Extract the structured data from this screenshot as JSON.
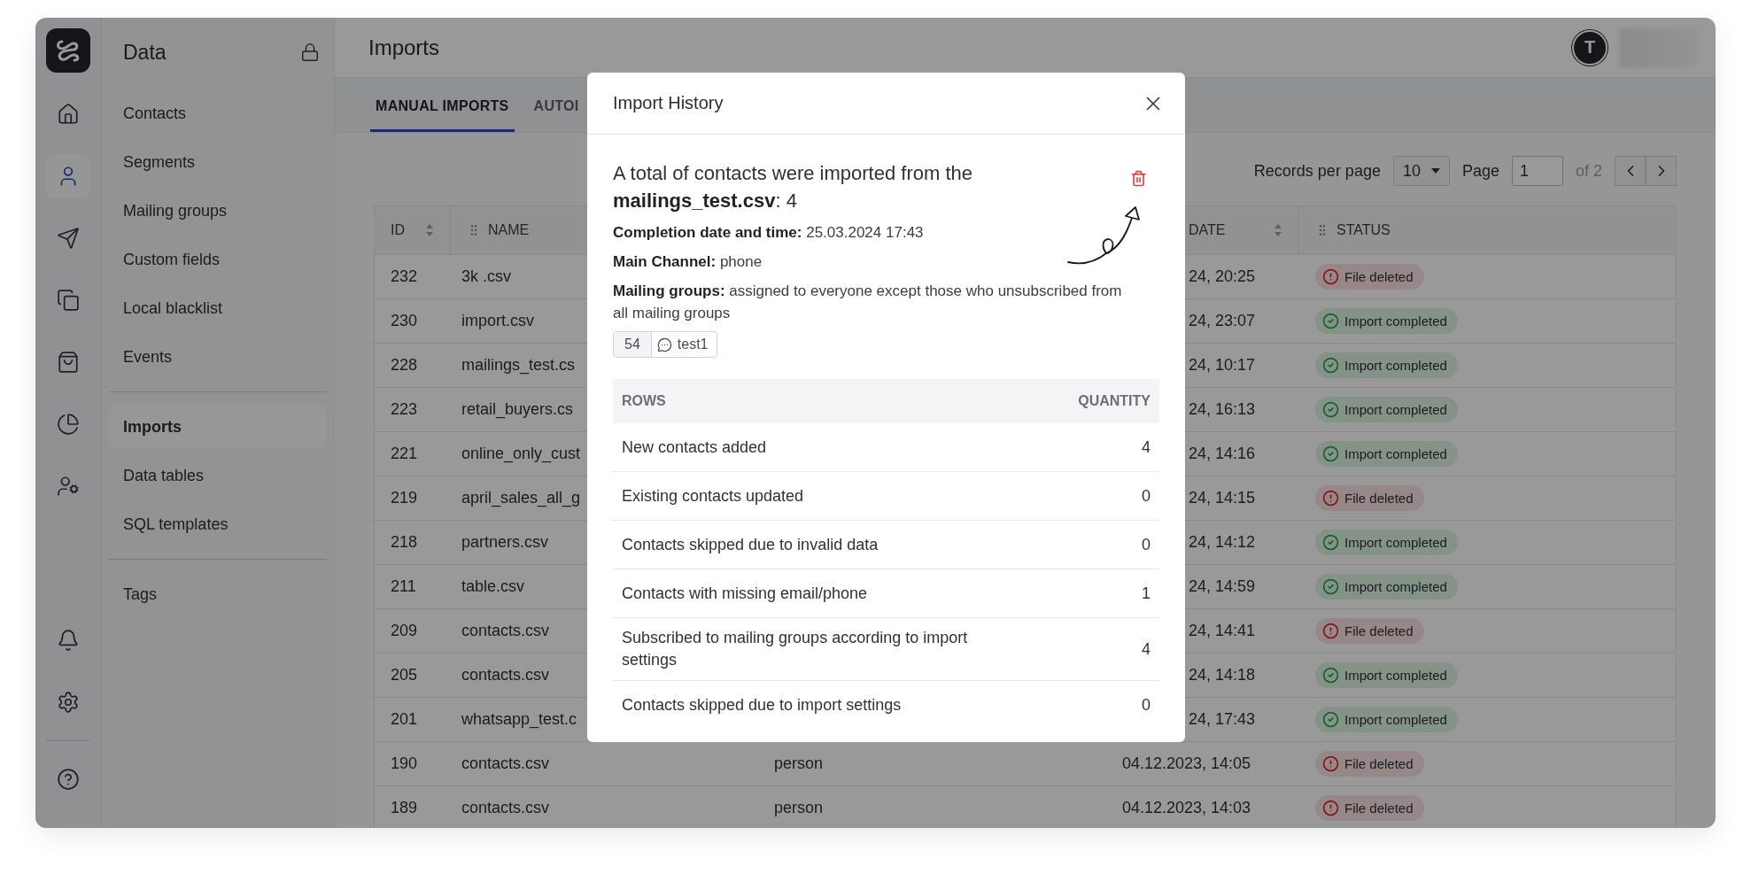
{
  "rail": {
    "top": [
      {
        "selected": false
      },
      {
        "selected": true
      },
      {
        "selected": false
      },
      {
        "selected": false
      },
      {
        "selected": false
      },
      {
        "selected": false
      },
      {
        "selected": false
      }
    ],
    "bottom": [
      {
        "selected": false
      },
      {
        "selected": false
      },
      {
        "selected": false
      }
    ]
  },
  "sidebar": {
    "title": "Data",
    "sections": [
      [
        {
          "label": "Contacts",
          "selected": false
        },
        {
          "label": "Segments",
          "selected": false
        },
        {
          "label": "Mailing groups",
          "selected": false
        },
        {
          "label": "Custom fields",
          "selected": false
        },
        {
          "label": "Local blacklist",
          "selected": false
        },
        {
          "label": "Events",
          "selected": false
        }
      ],
      [
        {
          "label": "Imports",
          "selected": true
        },
        {
          "label": "Data tables",
          "selected": false
        },
        {
          "label": "SQL templates",
          "selected": false
        }
      ],
      [
        {
          "label": "Tags",
          "selected": false
        }
      ]
    ]
  },
  "header": {
    "title": "Imports",
    "avatar": "T"
  },
  "tabs": [
    {
      "label": "MANUAL IMPORTS",
      "selected": true
    },
    {
      "label": "AUTOI",
      "selected": false
    }
  ],
  "pagination": {
    "records_label": "Records per page",
    "per_page": "10",
    "page_label": "Page",
    "page": "1",
    "of": "of 2"
  },
  "table": {
    "columns": [
      {
        "label": "ID",
        "kind": "sort"
      },
      {
        "label": "NAME",
        "kind": "drag"
      },
      {
        "label": "DATE",
        "kind": "sort"
      },
      {
        "label": "STATUS",
        "kind": "drag"
      }
    ],
    "rows": [
      {
        "kind": "covered",
        "id": "232",
        "name": "3k .csv",
        "date": "24, 20:25",
        "status": {
          "kind": "error",
          "label": "File deleted"
        }
      },
      {
        "kind": "covered",
        "id": "230",
        "name": "import.csv",
        "date": "24, 23:07",
        "status": {
          "kind": "success",
          "label": "Import completed"
        }
      },
      {
        "kind": "covered",
        "id": "228",
        "name": "mailings_test.cs",
        "date": "24, 10:17",
        "status": {
          "kind": "success",
          "label": "Import completed"
        }
      },
      {
        "kind": "covered",
        "id": "223",
        "name": "retail_buyers.cs",
        "date": "24, 16:13",
        "status": {
          "kind": "success",
          "label": "Import completed"
        }
      },
      {
        "kind": "covered",
        "id": "221",
        "name": "online_only_cust",
        "date": "24, 14:16",
        "status": {
          "kind": "success",
          "label": "Import completed"
        }
      },
      {
        "kind": "covered",
        "id": "219",
        "name": "april_sales_all_g",
        "date": "24, 14:15",
        "status": {
          "kind": "error",
          "label": "File deleted"
        }
      },
      {
        "kind": "covered",
        "id": "218",
        "name": "partners.csv",
        "date": "24, 14:12",
        "status": {
          "kind": "success",
          "label": "Import completed"
        }
      },
      {
        "kind": "covered",
        "id": "211",
        "name": "table.csv",
        "date": "24, 14:59",
        "status": {
          "kind": "success",
          "label": "Import completed"
        }
      },
      {
        "kind": "covered",
        "id": "209",
        "name": "contacts.csv",
        "date": "24, 14:41",
        "status": {
          "kind": "error",
          "label": "File deleted"
        }
      },
      {
        "kind": "covered",
        "id": "205",
        "name": "contacts.csv",
        "date": "24, 14:18",
        "status": {
          "kind": "success",
          "label": "Import completed"
        }
      },
      {
        "kind": "covered",
        "id": "201",
        "name": "whatsapp_test.c",
        "date": "24, 17:43",
        "status": {
          "kind": "success",
          "label": "Import completed"
        }
      },
      {
        "kind": "full",
        "id": "190",
        "name": "contacts.csv",
        "channel": "person",
        "date": "04.12.2023, 14:05",
        "status": {
          "kind": "error",
          "label": "File deleted"
        }
      },
      {
        "kind": "full",
        "id": "189",
        "name": "contacts.csv",
        "channel": "person",
        "date": "04.12.2023, 14:03",
        "status": {
          "kind": "error",
          "label": "File deleted"
        }
      }
    ]
  },
  "modal": {
    "title": "Import History",
    "summary": "A total of contacts were imported from the **mailings_test.csv**: 4",
    "details": [
      "**Completion date and time:** 25.03.2024 17:43",
      "**Main Channel:** phone",
      "**Mailing groups:** assigned to everyone except those who unsubscribed from all mailing groups"
    ],
    "tag": {
      "count": "54",
      "name": "test1"
    },
    "columns": [
      "ROWS",
      "QUANTITY"
    ],
    "rows": [
      {
        "label": "New contacts added",
        "value": "4"
      },
      {
        "label": "Existing contacts updated",
        "value": "0"
      },
      {
        "label": "Contacts skipped due to invalid data",
        "value": "0"
      },
      {
        "label": "Contacts with missing email/phone",
        "value": "1"
      },
      {
        "label": "Subscribed to mailing groups according to import settings",
        "value": "4"
      },
      {
        "label": "Contacts skipped due to import settings",
        "value": "0"
      }
    ]
  }
}
